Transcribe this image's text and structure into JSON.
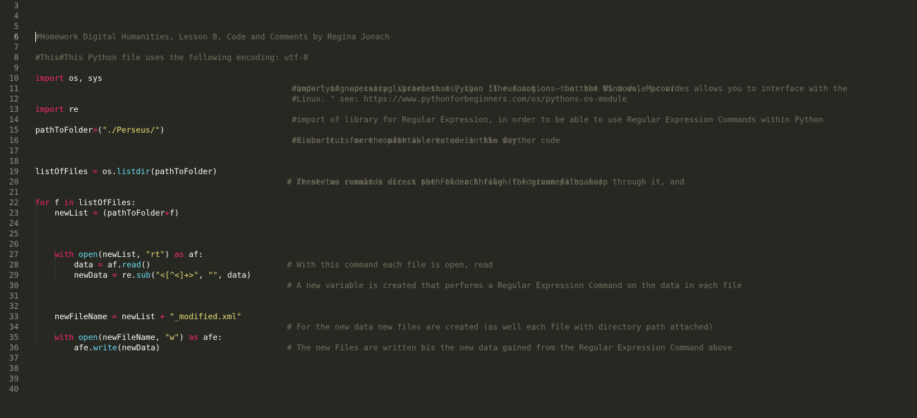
{
  "editor": {
    "line_numbers": [
      "3",
      "4",
      "5",
      "6",
      "7",
      "8",
      "9",
      "10",
      "11",
      "12",
      "13",
      "14",
      "15",
      "16",
      "17",
      "18",
      "19",
      "20",
      "21",
      "22",
      "23",
      "24",
      "25",
      "26",
      "27",
      "28",
      "29",
      "30",
      "31",
      "32",
      "33",
      "34",
      "35",
      "36",
      "37",
      "38",
      "39",
      "40"
    ],
    "header_comment": "#Homework Digital Humanities, Lesson 8, Code and Comments by Regina Jonach",
    "encoding_comment": "#This#This Python file uses the following encoding: utf-8",
    "l9_code": "os, sys",
    "l9_comment": "#import of necessary libraries: os, sys. \"The functions that the OS module provides allows you to interface with the",
    "l10_comment": "#underlying operating system that Python is running on – be that Windows, Mac or",
    "l11_comment": "#Linux. \" see: https://www.pythonforbeginners.com/os/pythons-os-module",
    "l12_code": "re",
    "l12_comment": "#import of library for Regular Expression, in order to be able to use Regular Expression Commands within Python",
    "l14_var": "pathToFolder",
    "l14_str": "\"./Perseus/\"",
    "l14_comment": "#Since it is more comfortable to use in the further code",
    "l15_comment": "#a shortcut for the path is created in this way",
    "l18_var": "listOfFiles",
    "l18_obj": "os.",
    "l18_fn": "listdir",
    "l18_arg": "(pathToFolder)",
    "l18_comment": "# These two commands access the Folder through the given path, loop through it, and",
    "l19_comment": "# create as result a direct path to each file (foldernamefilename)",
    "l21_var": "f",
    "l21_iter": "listOfFiles:",
    "l22_var": "newList",
    "l22_a": "(pathToFolder",
    "l22_b": "f)",
    "l26_fn": "open",
    "l26_a": "(newList, ",
    "l26_str": "\"rt\"",
    "l26_b": ")",
    "l26_var": "af:",
    "l26_comment": "# With this command each file is open, read",
    "l27_var": "data",
    "l27_obj": "af.",
    "l27_fn": "read",
    "l27_end": "()",
    "l28_var": "newData",
    "l28_obj": "re.",
    "l28_fn": "sub",
    "l28_str1": "\"<[^<]+>\"",
    "l28_str2": "\"\"",
    "l28_end": ", data)",
    "l28_comment": "# A new variable is created that performs a Regular Expression Command on the data in each file",
    "l32_var": "newFileName",
    "l32_mid": "newList",
    "l32_str": "\"_modified.xml\"",
    "l32_comment": "# For the new data new files are created (as well each file with directory path attached)",
    "l34_fn": "open",
    "l34_a": "(newFileName, ",
    "l34_str": "\"w\"",
    "l34_b": ")",
    "l34_var": "afe:",
    "l34_comment": "# The new Files are written bis the new data gained from the Regular Expression Command above",
    "l35_obj": "afe.",
    "l35_fn": "write",
    "l35_end": "(newData)",
    "kw_import": "import",
    "kw_for": "for",
    "kw_in": "in",
    "kw_with": "with",
    "kw_as": "as"
  }
}
